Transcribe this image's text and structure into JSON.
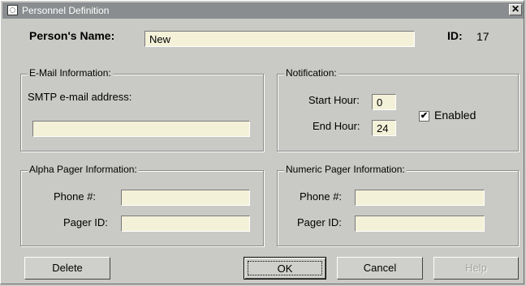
{
  "window": {
    "title": "Personnel Definition",
    "close_glyph": "✕"
  },
  "person": {
    "name_label": "Person's Name:",
    "name_value": "New",
    "id_label": "ID:",
    "id_value": "17"
  },
  "email": {
    "group_title": "E-Mail Information:",
    "smtp_label": "SMTP e-mail address:",
    "smtp_value": ""
  },
  "notification": {
    "group_title": "Notification:",
    "start_label": "Start Hour:",
    "start_value": "0",
    "end_label": "End Hour:",
    "end_value": "24",
    "enabled_label": "Enabled",
    "enabled_checked": true,
    "check_glyph": "✔"
  },
  "alpha_pager": {
    "group_title": "Alpha Pager Information:",
    "phone_label": "Phone #:",
    "phone_value": "",
    "pager_label": "Pager ID:",
    "pager_value": ""
  },
  "numeric_pager": {
    "group_title": "Numeric Pager Information:",
    "phone_label": "Phone #:",
    "phone_value": "",
    "pager_label": "Pager ID:",
    "pager_value": ""
  },
  "buttons": {
    "delete": "Delete",
    "ok": "OK",
    "cancel": "Cancel",
    "help": "Help"
  }
}
